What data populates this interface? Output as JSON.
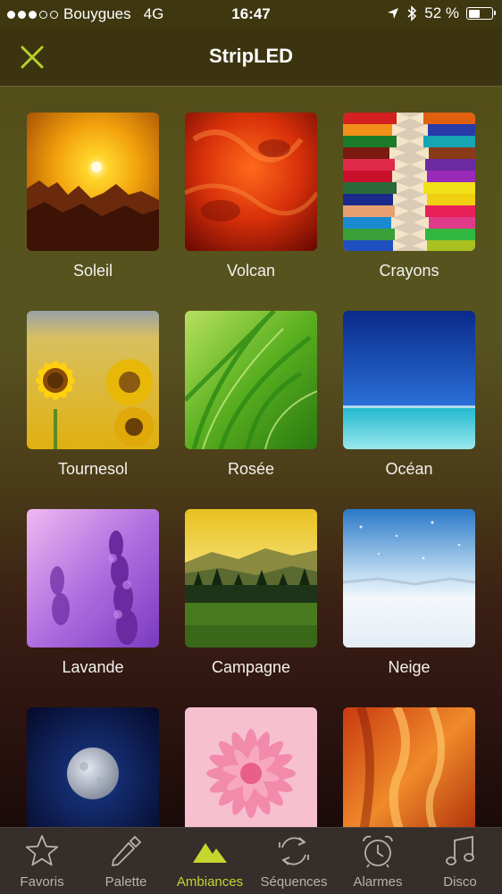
{
  "status_bar": {
    "carrier": "Bouygues",
    "network": "4G",
    "time": "16:47",
    "battery_text": "52 %",
    "battery_level": 0.52,
    "signal_bars_filled": 3,
    "signal_bars_total": 5,
    "icons": [
      "location-arrow-icon",
      "bluetooth-icon",
      "battery-icon"
    ]
  },
  "nav": {
    "title": "StripLED",
    "close_icon": "close-icon",
    "accent_color": "#b8d12a"
  },
  "ambiances": [
    {
      "label": "Soleil",
      "image": "sunset-mountains"
    },
    {
      "label": "Volcan",
      "image": "lava-red"
    },
    {
      "label": "Crayons",
      "image": "colored-pencils"
    },
    {
      "label": "Tournesol",
      "image": "sunflowers"
    },
    {
      "label": "Rosée",
      "image": "dewy-grass"
    },
    {
      "label": "Océan",
      "image": "ocean-horizon"
    },
    {
      "label": "Lavande",
      "image": "lavender"
    },
    {
      "label": "Campagne",
      "image": "countryside"
    },
    {
      "label": "Neige",
      "image": "snow"
    },
    {
      "label": "",
      "image": "moon"
    },
    {
      "label": "",
      "image": "pink-flower"
    },
    {
      "label": "",
      "image": "orange-canyon"
    }
  ],
  "tabbar": {
    "active_tab": "Ambiances",
    "active_color": "#c5d62f",
    "tabs": [
      {
        "label": "Favoris",
        "icon": "star-icon"
      },
      {
        "label": "Palette",
        "icon": "dropper-icon"
      },
      {
        "label": "Ambiances",
        "icon": "mountains-icon"
      },
      {
        "label": "Séquences",
        "icon": "cycle-arrows-icon"
      },
      {
        "label": "Alarmes",
        "icon": "alarm-clock-icon"
      },
      {
        "label": "Disco",
        "icon": "music-note-icon"
      }
    ]
  }
}
